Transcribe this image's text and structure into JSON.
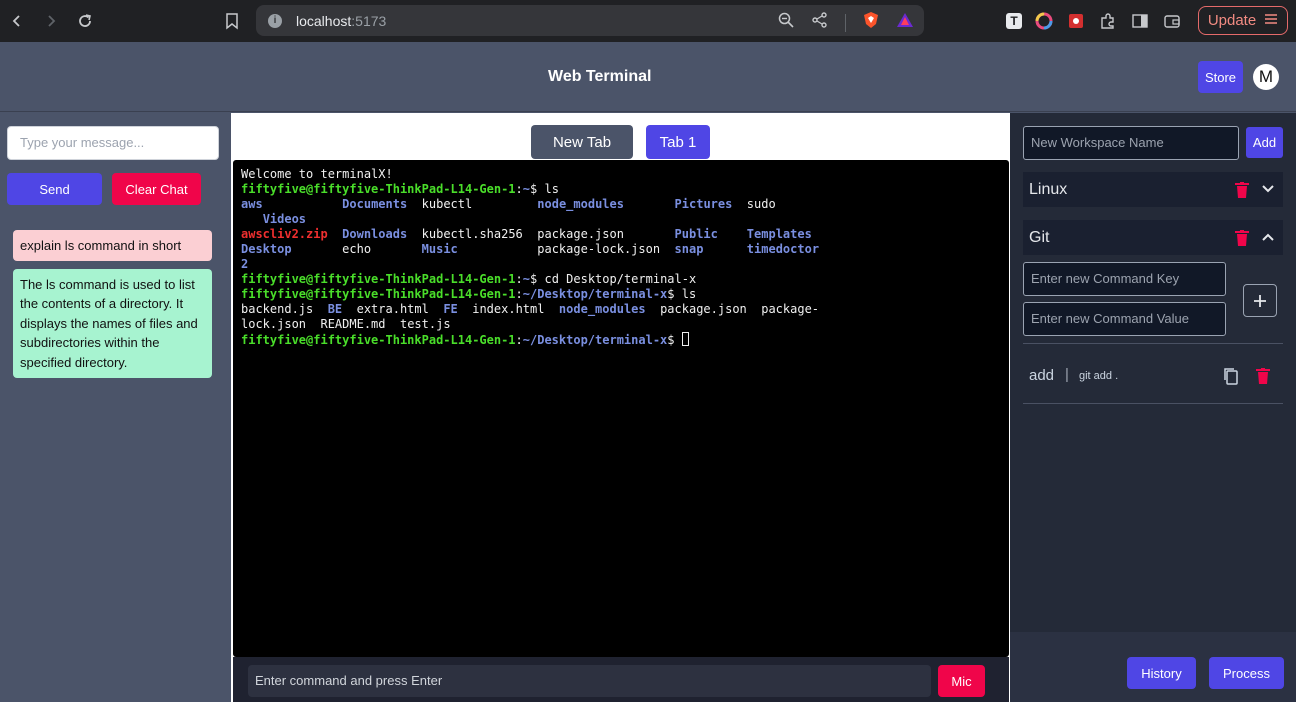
{
  "browser": {
    "url_host": "localhost",
    "url_port": ":5173",
    "update_label": "Update",
    "avatar_ext_letter": "T"
  },
  "header": {
    "title": "Web Terminal",
    "store_label": "Store",
    "avatar_initial": "M"
  },
  "chat": {
    "input_placeholder": "Type your message...",
    "send_label": "Send",
    "clear_label": "Clear Chat",
    "messages": [
      {
        "role": "user",
        "text": "explain ls command in short"
      },
      {
        "role": "assistant",
        "text": "The ls command is used to list the contents of a directory. It displays the names of files and subdirectories within the specified directory."
      }
    ]
  },
  "tabs": {
    "new_tab_label": "New Tab",
    "tab1_label": "Tab 1"
  },
  "terminal": {
    "welcome": "Welcome to terminalX!",
    "prompt_user": "fiftyfive@fiftyfive-ThinkPad-L14-Gen-1",
    "home": "~",
    "cwd": "~/Desktop/terminal-x",
    "cmd1": "ls",
    "cmd2": "cd Desktop/terminal-x",
    "cmd3": "ls",
    "ls1": {
      "aws": "aws",
      "Documents": "Documents",
      "kubectl": "kubectl",
      "node_modules": "node_modules",
      "Pictures": "Pictures",
      "sudo": "sudo",
      "Videos": "Videos",
      "awscliv2": "awscliv2.zip",
      "Downloads": "Downloads",
      "kubectl_sha": "kubectl.sha256",
      "package_json": "package.json",
      "Public": "Public",
      "Templates": "Templates",
      "Desktop": "Desktop",
      "echo": "echo",
      "Music": "Music",
      "package_lock": "package-lock.json",
      "snap": "snap",
      "timedoctor": "timedoctor",
      "two": "2"
    },
    "ls2": {
      "backend": "backend.js",
      "BE": "BE",
      "extra": "extra.html",
      "FE": "FE",
      "index": "index.html",
      "node_modules": "node_modules",
      "package_json": "package.json",
      "package_a": "package-",
      "package_b": "lock.json",
      "readme": "README.md",
      "test": "test.js"
    },
    "command_placeholder": "Enter command and press Enter",
    "mic_label": "Mic"
  },
  "workspaces": {
    "name_placeholder": "New Workspace Name",
    "add_label": "Add",
    "items": [
      {
        "name": "Linux",
        "expanded": false
      },
      {
        "name": "Git",
        "expanded": true
      }
    ],
    "key_placeholder": "Enter new Command Key",
    "value_placeholder": "Enter new Command Value",
    "commands": [
      {
        "key": "add",
        "separator": "|",
        "value": "git add ."
      }
    ],
    "history_label": "History",
    "process_label": "Process"
  },
  "colors": {
    "accent": "#4f46e5",
    "danger": "#f0054a",
    "terminal_green": "#4ade2a",
    "terminal_blue": "#7a8fe0"
  }
}
